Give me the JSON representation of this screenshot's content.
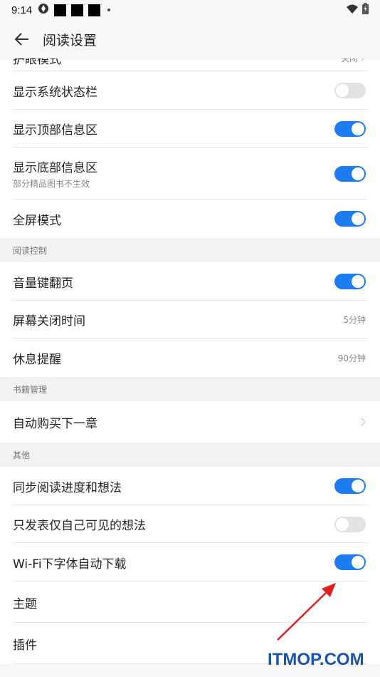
{
  "status_bar": {
    "time": "9:14",
    "icons": [
      "sync-icon",
      "notification-square-icon",
      "notification-square-icon",
      "notification-square-icon",
      "more-dot-icon",
      "wifi-icon",
      "battery-icon"
    ]
  },
  "app_bar": {
    "back_icon": "arrow-left-icon",
    "title": "阅读设置"
  },
  "rows_top": [
    {
      "label": "护眼模式",
      "value": "关闭",
      "type": "link"
    },
    {
      "label": "显示系统状态栏",
      "type": "toggle",
      "on": false
    },
    {
      "label": "显示顶部信息区",
      "type": "toggle",
      "on": true
    },
    {
      "label": "显示底部信息区",
      "sub": "部分精品图书不生效",
      "type": "toggle",
      "on": true
    },
    {
      "label": "全屏模式",
      "type": "toggle",
      "on": true
    }
  ],
  "section_reading": {
    "header": "阅读控制",
    "rows": [
      {
        "label": "音量键翻页",
        "type": "toggle",
        "on": true
      },
      {
        "label": "屏幕关闭时间",
        "value": "5分钟",
        "type": "value"
      },
      {
        "label": "休息提醒",
        "value": "90分钟",
        "type": "value"
      }
    ]
  },
  "section_books": {
    "header": "书籍管理",
    "rows": [
      {
        "label": "自动购买下一章",
        "type": "link"
      }
    ]
  },
  "section_other": {
    "header": "其他",
    "rows": [
      {
        "label": "同步阅读进度和想法",
        "type": "toggle",
        "on": true
      },
      {
        "label": "只发表仅自己可见的想法",
        "type": "toggle",
        "on": false
      },
      {
        "label": "Wi-Fi下字体自动下载",
        "type": "toggle",
        "on": true
      },
      {
        "label": "主题",
        "type": "plain"
      },
      {
        "label": "插件",
        "type": "plain"
      }
    ]
  },
  "colors": {
    "accent": "#1e7cf2",
    "toggle_off": "#e2e2e2",
    "annotation_arrow": "#e02020",
    "watermark": "#1a55b0"
  },
  "watermark": "ITMOP.COM"
}
